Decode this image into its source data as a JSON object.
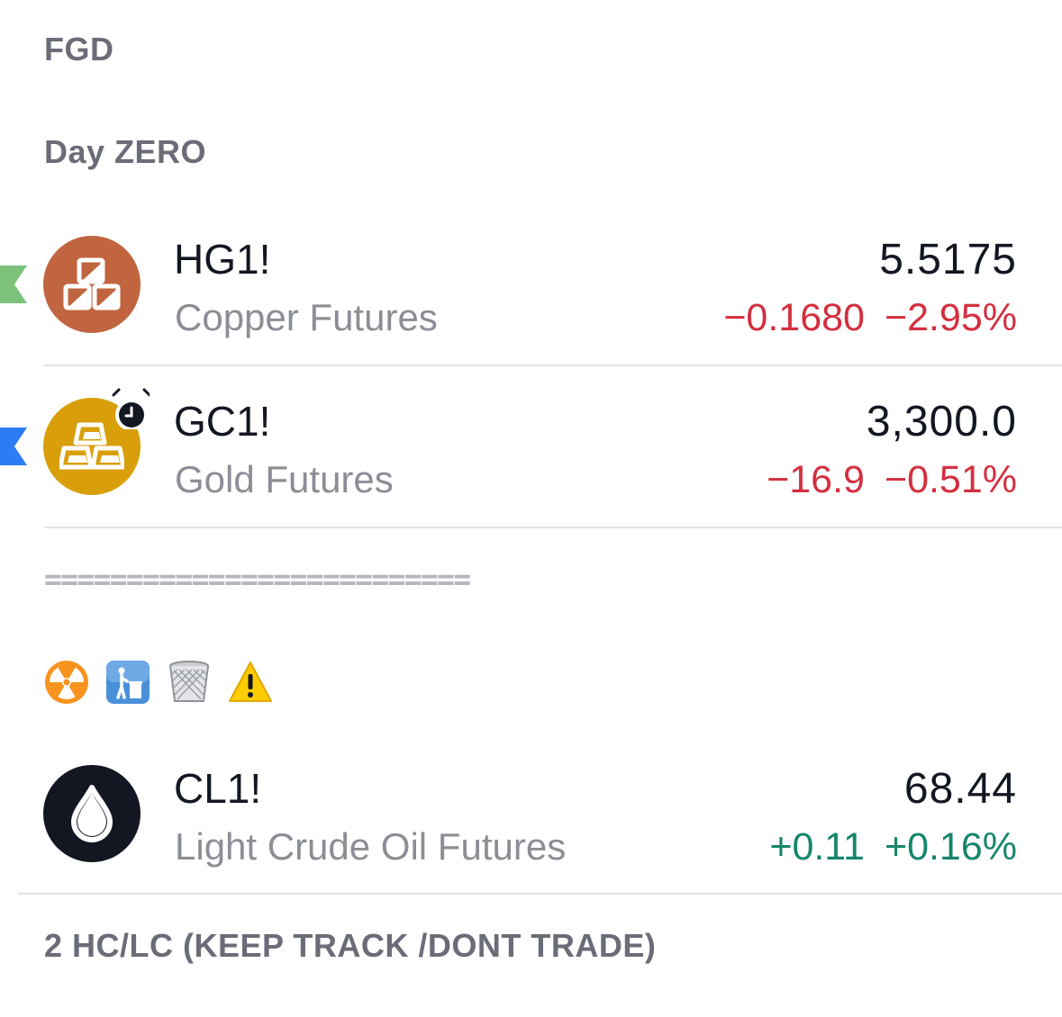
{
  "sections": {
    "fgd": "FGD",
    "day_zero": "Day ZERO",
    "hc_lc": "2 HC/LC (KEEP TRACK /DONT TRADE)"
  },
  "separator_text": "==========================",
  "emoji_row": [
    "radioactive-icon",
    "put-litter-in-its-place-icon",
    "wastebasket-icon",
    "warning-icon"
  ],
  "watchlist": [
    {
      "symbol": "HG1!",
      "description": "Copper Futures",
      "price": "5.5175",
      "change": "−0.1680",
      "change_percent": "−2.95%",
      "direction": "down",
      "logo_icon": "copper-blocks-icon",
      "logo_color": "#c0653f",
      "flag_color": "#7dc17a"
    },
    {
      "symbol": "GC1!",
      "description": "Gold Futures",
      "price": "3,300.0",
      "change": "−16.9",
      "change_percent": "−0.51%",
      "direction": "down",
      "logo_icon": "gold-bars-icon",
      "logo_color": "#d89f0a",
      "flag_color": "#2c7cf6",
      "has_alert": true
    },
    {
      "symbol": "CL1!",
      "description": "Light Crude Oil Futures",
      "price": "68.44",
      "change": "+0.11",
      "change_percent": "+0.16%",
      "direction": "up",
      "logo_icon": "oil-drop-icon",
      "logo_color": "#131722"
    }
  ],
  "colors": {
    "negative": "#d32f3f",
    "positive": "#15866b",
    "header_gray": "#6a6d78",
    "description_gray": "#8c8e96"
  }
}
